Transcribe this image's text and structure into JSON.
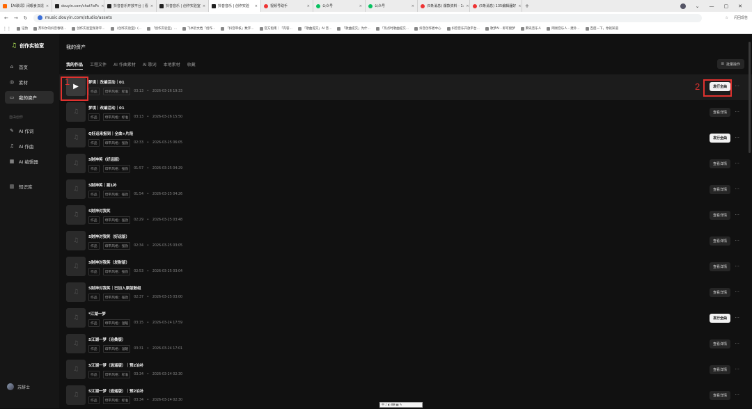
{
  "browser": {
    "tabs": [
      {
        "label": "【AI歌词】闭眼食汉逞",
        "icon": "orange"
      },
      {
        "label": "douyin.com/chat?isPc",
        "icon": "dark"
      },
      {
        "label": "抖音音乐开放平台 | 看",
        "icon": "dark"
      },
      {
        "label": "抖音音乐 | 创作实验室",
        "icon": "dark"
      },
      {
        "label": "抖音音乐 | 创作实验",
        "icon": "dark",
        "active": true
      },
      {
        "label": "视频号助手",
        "icon": "red"
      },
      {
        "label": "公众号",
        "icon": "green"
      },
      {
        "label": "公众号",
        "icon": "green"
      },
      {
        "label": "(5条消息) 爆款资料 · 1:",
        "icon": "red"
      },
      {
        "label": "(5条消息) 135编辑器好",
        "icon": "red"
      }
    ],
    "url": "music.douyin.com/studio/assets",
    "profile_label": "闪回现告",
    "bookmarks": [
      "证伪",
      "苏科尔的抖音春晓...",
      "创作实验室保持平...",
      "《创作实验室》(...",
      "「创作实验室」...",
      "飞书云文档「创作...",
      "「抖音审核」数字...",
      "官方指南｜「内容...",
      "「歌曲提交」AI 音...",
      "「歌曲提交」为什...",
      "「热点时歌曲提交...",
      "抖音创作者中心",
      "抖音音乐开放平台...",
      "歌梦AI - 即可接梦",
      "腾讯音乐人",
      "网易音乐人 - 建外...",
      "百度一下，你就知道"
    ]
  },
  "sidebar": {
    "logo": "创作实验室",
    "items": [
      {
        "label": "首页",
        "icon": "home-icon",
        "glyph": "⌂"
      },
      {
        "label": "素材",
        "icon": "location-icon",
        "glyph": "◎"
      },
      {
        "label": "我的资产",
        "icon": "folder-icon",
        "glyph": "▭",
        "active": true
      }
    ],
    "section": "自由创作",
    "tools": [
      {
        "label": "AI 作词",
        "icon": "lyrics-icon",
        "glyph": "✎"
      },
      {
        "label": "AI 作曲",
        "icon": "music-note-icon",
        "glyph": "♫"
      },
      {
        "label": "AI 编辑器",
        "icon": "editor-icon",
        "glyph": "▦"
      }
    ],
    "library": {
      "label": "知识库",
      "icon": "book-icon",
      "glyph": "▥"
    },
    "user": "苏辞士"
  },
  "main": {
    "title": "我的资产",
    "tabs": [
      "我的作品",
      "工程文件",
      "AI 作曲素材",
      "AI 歌词",
      "本地素材",
      "收藏"
    ],
    "batch": "批量操作"
  },
  "rows": [
    {
      "title": "梦境｜改编活动｜01",
      "type": "作品",
      "style": "母带风格：标准",
      "dur": "03:13",
      "date": "2026-03-26 19:33",
      "action": "发行全曲",
      "primary": true,
      "playing": true
    },
    {
      "title": "梦境｜改编活动｜01",
      "type": "作品",
      "style": "母带风格：标准",
      "dur": "03:13",
      "date": "2026-03-26 15:50",
      "action": "查看详情"
    },
    {
      "title": "Q好运来报到｜全曲+片段",
      "type": "作品",
      "style": "母带风格：强劲",
      "dur": "02:33",
      "date": "2026-03-25 06:05",
      "action": "发行全曲",
      "primary": true
    },
    {
      "title": "S财神笑（好运版）",
      "type": "作品",
      "style": "母带风格：强劲",
      "dur": "01:57",
      "date": "2026-03-25 04:29",
      "action": "查看详情"
    },
    {
      "title": "S财神笑｜副1补",
      "type": "作品",
      "style": "母带风格：强劲",
      "dur": "01:54",
      "date": "2026-03-25 04:26",
      "action": "查看详情"
    },
    {
      "title": "S财神对我笑",
      "type": "作品",
      "style": "母带风格：强劲",
      "dur": "02:29",
      "date": "2026-03-25 03:48",
      "action": "查看详情"
    },
    {
      "title": "S财神对我笑（好运版）",
      "type": "作品",
      "style": "母带风格：强劲",
      "dur": "02:34",
      "date": "2026-03-25 03:05",
      "action": "查看详情"
    },
    {
      "title": "S财神对我笑（发财版）",
      "type": "作品",
      "style": "母带风格：强劲",
      "dur": "02:53",
      "date": "2026-03-25 03:04",
      "action": "查看详情"
    },
    {
      "title": "S财神对我笑｜已加入原版鼓组",
      "type": "作品",
      "style": "母带风格：强劲",
      "dur": "02:37",
      "date": "2026-03-25 03:00",
      "action": "查看详情"
    },
    {
      "title": "*江湖一梦",
      "type": "作品",
      "style": "母带风格：温暖",
      "dur": "03:15",
      "date": "2026-03-24 17:59",
      "action": "发行全曲",
      "primary": true
    },
    {
      "title": "S江湖一梦（沧桑版）",
      "type": "作品",
      "style": "母带风格：温暖",
      "dur": "03:31",
      "date": "2026-03-24 17:01",
      "action": "查看详情"
    },
    {
      "title": "S江湖一梦（逍遥版）｜预2泊补",
      "type": "作品",
      "style": "母带风格：标准",
      "dur": "03:34",
      "date": "2026-03-24 02:30",
      "action": "查看详情"
    },
    {
      "title": "S江湖一梦（逍遥版）｜预2泊补",
      "type": "作品",
      "style": "母带风格：标准",
      "dur": "03:34",
      "date": "2026-03-24 02:30",
      "action": "查看详情"
    }
  ],
  "annotations": {
    "one": "1",
    "two": "2"
  },
  "ime": "中 ♪ ◐ ⌨ ▦ ✎"
}
